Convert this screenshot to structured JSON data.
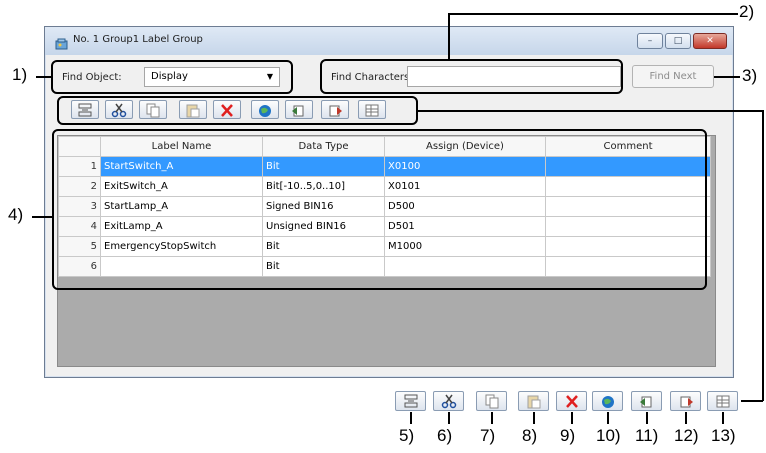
{
  "window": {
    "title": "No. 1 Group1 Label Group",
    "minimize_label": "–",
    "maximize_label": "□",
    "close_label": "✕"
  },
  "search": {
    "find_object_label": "Find Object:",
    "find_object_value": "Display",
    "find_characters_label": "Find Characters:",
    "find_characters_value": "",
    "find_next_label": "Find Next"
  },
  "toolbar": {
    "buttons": [
      {
        "icon": "row-insert-icon",
        "color": "#555555"
      },
      {
        "icon": "cut-icon",
        "color": "#1f4f9e"
      },
      {
        "icon": "copy-icon",
        "color": "#888888"
      },
      {
        "icon": "paste-icon",
        "color": "#a0a0a0"
      },
      {
        "icon": "delete-icon",
        "color": "#e02020"
      },
      {
        "icon": "globe-icon",
        "color": "#1f74c6"
      },
      {
        "icon": "import-icon",
        "color": "#3a7a3a"
      },
      {
        "icon": "export-icon",
        "color": "#c0392b"
      },
      {
        "icon": "table-icon",
        "color": "#777777"
      }
    ]
  },
  "table": {
    "columns": [
      "",
      "Label Name",
      "Data Type",
      "Assign (Device)",
      "Comment"
    ],
    "rows": [
      {
        "num": "1",
        "label": "StartSwitch_A",
        "type": "Bit",
        "device": "X0100",
        "comment": ""
      },
      {
        "num": "2",
        "label": "ExitSwitch_A",
        "type": "Bit[-10..5,0..10]",
        "device": "X0101",
        "comment": ""
      },
      {
        "num": "3",
        "label": "StartLamp_A",
        "type": "Signed BIN16",
        "device": "D500",
        "comment": ""
      },
      {
        "num": "4",
        "label": "ExitLamp_A",
        "type": "Unsigned BIN16",
        "device": "D501",
        "comment": ""
      },
      {
        "num": "5",
        "label": "EmergencyStopSwitch",
        "type": "Bit",
        "device": "M1000",
        "comment": ""
      },
      {
        "num": "6",
        "label": "",
        "type": "Bit",
        "device": "",
        "comment": ""
      }
    ],
    "selected_row": 1,
    "selection_color": "#3399ff"
  },
  "callouts": {
    "c1": "1)",
    "c2": "2)",
    "c3": "3)",
    "c4": "4)",
    "c5": "5)",
    "c6": "6)",
    "c7": "7)",
    "c8": "8)",
    "c9": "9)",
    "c10": "10)",
    "c11": "11)",
    "c12": "12)",
    "c13": "13)"
  }
}
